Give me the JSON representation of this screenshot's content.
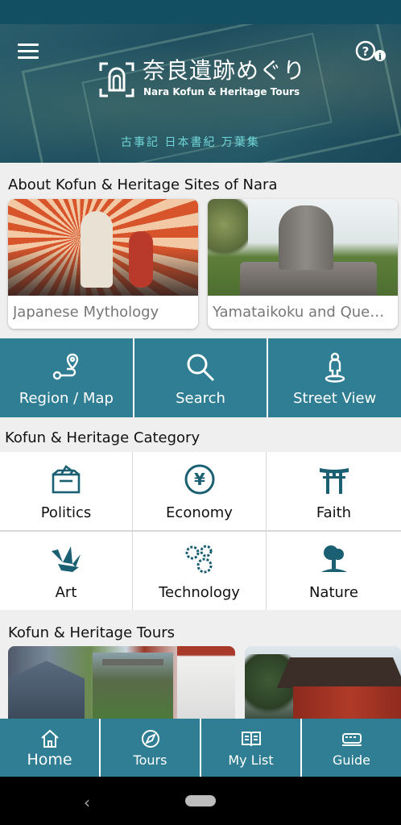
{
  "header": {
    "logo_jp": "奈良遺跡めぐり",
    "logo_en": "Nara Kofun & Heritage Tours",
    "logo_sub": "古事記 日本書紀 万葉集",
    "menu_icon": "hamburger-menu-icon",
    "help_icon": "help-info-icon"
  },
  "about": {
    "title": "About Kofun & Heritage Sites of Nara",
    "cards": [
      {
        "label": "Japanese Mythology"
      },
      {
        "label": "Yamataikoku and Queen Himiko"
      }
    ]
  },
  "quicknav": [
    {
      "label": "Region / Map",
      "icon": "route-map-icon"
    },
    {
      "label": "Search",
      "icon": "search-icon"
    },
    {
      "label": "Street View",
      "icon": "street-view-person-icon"
    }
  ],
  "category": {
    "title": "Kofun & Heritage Category",
    "items": [
      {
        "label": "Politics",
        "icon": "ballot-box-icon"
      },
      {
        "label": "Economy",
        "icon": "yen-coin-icon"
      },
      {
        "label": "Faith",
        "icon": "torii-gate-icon"
      },
      {
        "label": "Art",
        "icon": "origami-crane-icon"
      },
      {
        "label": "Technology",
        "icon": "gears-icon"
      },
      {
        "label": "Nature",
        "icon": "tree-icon"
      }
    ]
  },
  "tours": {
    "title": "Kofun & Heritage Tours"
  },
  "tabbar": {
    "items": [
      {
        "label": "Home",
        "icon": "home-icon"
      },
      {
        "label": "Tours",
        "icon": "tours-compass-icon"
      },
      {
        "label": "My List",
        "icon": "book-icon"
      },
      {
        "label": "Guide",
        "icon": "train-icon"
      }
    ]
  },
  "colors": {
    "accent": "#2f7e93",
    "statusbar": "#124f63",
    "icon": "#1b5f73"
  }
}
